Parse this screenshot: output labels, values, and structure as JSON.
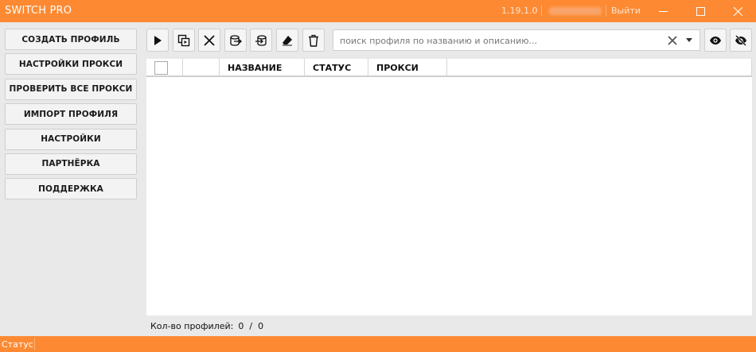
{
  "window": {
    "title": "SWITCH PRO",
    "version": "1.19.1.0",
    "logout_label": "Выйти",
    "accent_color": "#fd8a33"
  },
  "sidebar": {
    "items": [
      {
        "label": "СОЗДАТЬ ПРОФИЛЬ"
      },
      {
        "label": "НАСТРОЙКИ ПРОКСИ"
      },
      {
        "label": "ПРОВЕРИТЬ ВСЕ ПРОКСИ"
      },
      {
        "label": "ИМПОРТ ПРОФИЛЯ"
      },
      {
        "label": "НАСТРОЙКИ"
      },
      {
        "label": "ПАРТНЁРКА"
      },
      {
        "label": "ПОДДЕРЖКА"
      }
    ]
  },
  "toolbar": {
    "icons": [
      "play-icon",
      "copy-icon",
      "close-icon",
      "export-icon",
      "import-icon",
      "eraser-icon",
      "trash-icon",
      "eye-icon",
      "eye-off-icon"
    ]
  },
  "search": {
    "value": "",
    "placeholder": "поиск профиля по названию и описанию..."
  },
  "table": {
    "columns": [
      "",
      "",
      "НАЗВАНИЕ",
      "СТАТУС",
      "ПРОКСИ"
    ],
    "rows": []
  },
  "footer": {
    "count_label": "Кол-во профилей:",
    "count_value": "0  /  0"
  },
  "statusbar": {
    "text": "Статус"
  }
}
